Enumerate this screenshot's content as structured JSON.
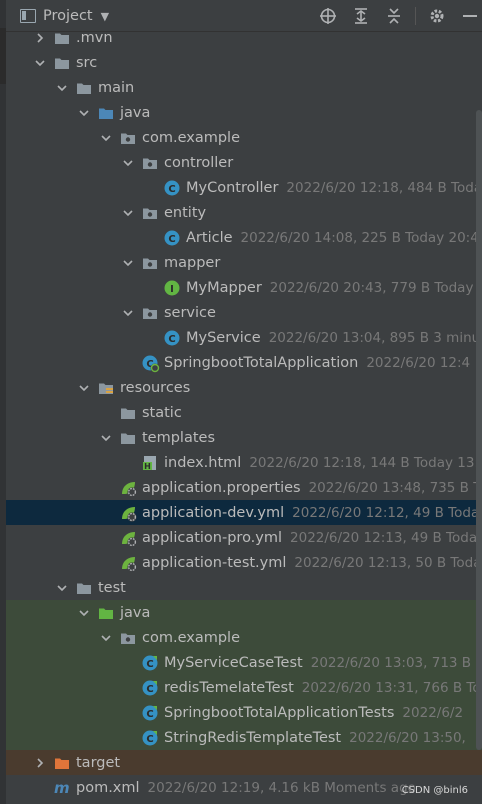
{
  "toolbar": {
    "title": "Project",
    "icons": [
      "target-icon",
      "expand-all-icon",
      "collapse-all-icon",
      "gear-icon",
      "minimize-icon"
    ]
  },
  "tree": [
    {
      "depth": 1,
      "arrow": "right",
      "icon": "folder",
      "name": ".mvn",
      "meta": ""
    },
    {
      "depth": 1,
      "arrow": "down",
      "icon": "folder",
      "name": "src",
      "meta": ""
    },
    {
      "depth": 2,
      "arrow": "down",
      "icon": "folder",
      "name": "main",
      "meta": ""
    },
    {
      "depth": 3,
      "arrow": "down",
      "icon": "folder-blue",
      "name": "java",
      "meta": ""
    },
    {
      "depth": 4,
      "arrow": "down",
      "icon": "package",
      "name": "com.example",
      "meta": ""
    },
    {
      "depth": 5,
      "arrow": "down",
      "icon": "package",
      "name": "controller",
      "meta": ""
    },
    {
      "depth": 6,
      "arrow": "none",
      "icon": "class",
      "name": "MyController",
      "meta": "2022/6/20 12:18, 484 B Toda"
    },
    {
      "depth": 5,
      "arrow": "down",
      "icon": "package",
      "name": "entity",
      "meta": ""
    },
    {
      "depth": 6,
      "arrow": "none",
      "icon": "class",
      "name": "Article",
      "meta": "2022/6/20 14:08, 225 B Today 20:44"
    },
    {
      "depth": 5,
      "arrow": "down",
      "icon": "package",
      "name": "mapper",
      "meta": ""
    },
    {
      "depth": 6,
      "arrow": "none",
      "icon": "interface",
      "name": "MyMapper",
      "meta": "2022/6/20 20:43, 779 B Today"
    },
    {
      "depth": 5,
      "arrow": "down",
      "icon": "package",
      "name": "service",
      "meta": ""
    },
    {
      "depth": 6,
      "arrow": "none",
      "icon": "class",
      "name": "MyService",
      "meta": "2022/6/20 13:04, 895 B 3 minut"
    },
    {
      "depth": 5,
      "arrow": "none",
      "icon": "springboot-class",
      "name": "SpringbootTotalApplication",
      "meta": "2022/6/20 12:4"
    },
    {
      "depth": 3,
      "arrow": "down",
      "icon": "resources",
      "name": "resources",
      "meta": ""
    },
    {
      "depth": 4,
      "arrow": "none",
      "icon": "folder",
      "name": "static",
      "meta": ""
    },
    {
      "depth": 4,
      "arrow": "down",
      "icon": "folder",
      "name": "templates",
      "meta": ""
    },
    {
      "depth": 5,
      "arrow": "none",
      "icon": "html",
      "name": "index.html",
      "meta": "2022/6/20 12:18, 144 B Today 13:4"
    },
    {
      "depth": 4,
      "arrow": "none",
      "icon": "spring-config",
      "name": "application.properties",
      "meta": "2022/6/20 13:48, 735 B T"
    },
    {
      "depth": 4,
      "arrow": "none",
      "icon": "spring-config",
      "name": "application-dev.yml",
      "meta": "2022/6/20 12:12, 49 B Today",
      "state": "selected"
    },
    {
      "depth": 4,
      "arrow": "none",
      "icon": "spring-config",
      "name": "application-pro.yml",
      "meta": "2022/6/20 12:13, 49 B Today"
    },
    {
      "depth": 4,
      "arrow": "none",
      "icon": "spring-config",
      "name": "application-test.yml",
      "meta": "2022/6/20 12:13, 50 B Toda"
    },
    {
      "depth": 2,
      "arrow": "down",
      "icon": "folder",
      "name": "test",
      "meta": ""
    },
    {
      "depth": 3,
      "arrow": "down",
      "icon": "folder-green",
      "name": "java",
      "meta": "",
      "state": "green"
    },
    {
      "depth": 4,
      "arrow": "down",
      "icon": "package",
      "name": "com.example",
      "meta": "",
      "state": "green"
    },
    {
      "depth": 5,
      "arrow": "none",
      "icon": "test-class",
      "name": "MyServiceCaseTest",
      "meta": "2022/6/20 13:03, 713 B 3",
      "state": "green"
    },
    {
      "depth": 5,
      "arrow": "none",
      "icon": "test-class",
      "name": "redisTemelateTest",
      "meta": "2022/6/20 13:31, 766 B To",
      "state": "green"
    },
    {
      "depth": 5,
      "arrow": "none",
      "icon": "test-class",
      "name": "SpringbootTotalApplicationTests",
      "meta": "2022/6/2",
      "state": "green"
    },
    {
      "depth": 5,
      "arrow": "none",
      "icon": "test-class",
      "name": "StringRedisTemplateTest",
      "meta": "2022/6/20 13:50,",
      "state": "green"
    },
    {
      "depth": 1,
      "arrow": "right",
      "icon": "folder-orange",
      "name": "target",
      "meta": "",
      "state": "orange"
    },
    {
      "depth": 1,
      "arrow": "none",
      "icon": "maven",
      "name": "pom.xml",
      "meta": "2022/6/20 12:19, 4.16 kB Moments ago"
    }
  ],
  "watermark": "CSDN @binl6",
  "colors": {
    "background": "#3c3f41",
    "selected_row": "#0d293e",
    "test_rows": "#3d4b3a",
    "excluded_rows": "#4a3b2e",
    "text": "#bbbbbb",
    "meta_text": "#787878",
    "folder": "#8c979f",
    "source_folder": "#4c87b7",
    "test_folder": "#62b543",
    "class_icon": "#3592c4",
    "interface_icon": "#62b543"
  }
}
